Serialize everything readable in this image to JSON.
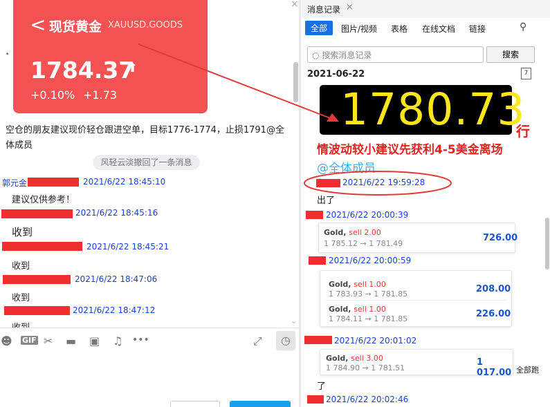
{
  "left": {
    "card": {
      "back": "<",
      "title": "现货黄金",
      "symbol": "XAUUSD.GOODS",
      "price": "1784.37",
      "arrow": "⬆",
      "pct": "+0.10%",
      "change": "+1.73"
    },
    "advice": "空仓的朋友建议现价轻仓跟进空单，目标1776-1774，止损1791@全体成员",
    "advice2": "体成员",
    "recall": "风轻云淡撤回了一条消息",
    "messages": [
      {
        "name": "郭元金",
        "time": "2021/6/22 18:45:10",
        "text": "建议仅供参考！"
      },
      {
        "time": "2021/6/22 18:45:16",
        "text": "收到"
      },
      {
        "time": "2021/6/22 18:45:21",
        "text": "收到"
      },
      {
        "time": "2021/6/22 18:47:06",
        "text": "收到"
      },
      {
        "time": "2021/6/22 18:47:12",
        "text": "收到"
      }
    ],
    "close_x": "×"
  },
  "right": {
    "tab": "消息记录",
    "tab_close": "×",
    "filters": [
      "全部",
      "图片/视频",
      "表格",
      "在线文档",
      "链接"
    ],
    "search_placeholder": "搜索消息记录",
    "search_btn": "搜索",
    "date": "2021-06-22",
    "led_value": "1780.73",
    "led_tail": "行",
    "red_text": "情波动较小建议先获利4-5美金离场",
    "mention": "@全体成员",
    "entries": [
      {
        "time": "2021/6/22 19:59:28",
        "text": "出了"
      },
      {
        "time": "2021/6/22 20:00:39"
      },
      {
        "time": "2021/6/22 20:00:59"
      },
      {
        "time": "2021/6/22 20:01:02"
      },
      {
        "time": "2021/6/22 20:02:46"
      }
    ],
    "trades": [
      {
        "label": "Gold,",
        "side": "sell 2.00",
        "prices": "1 785.12 → 1 781.49",
        "value": "726.00"
      },
      {
        "label": "Gold,",
        "side": "sell 1.00",
        "prices": "1 783.93 → 1 781.85",
        "value": "208.00"
      },
      {
        "label": "Gold,",
        "side": "sell 1.00",
        "prices": "1 784.11 → 1 781.85",
        "value": "226.00"
      },
      {
        "label": "Gold,",
        "side": "sell 3.00",
        "prices": "1 784.90 → 1 781.51",
        "value": "1 017.00"
      }
    ],
    "all_out": "全部跑",
    "le": "了"
  },
  "colors": {
    "accent": "#1b6fe0",
    "card": "#f45252",
    "led": "#ffe61a",
    "redact": "#ef2f2f"
  }
}
